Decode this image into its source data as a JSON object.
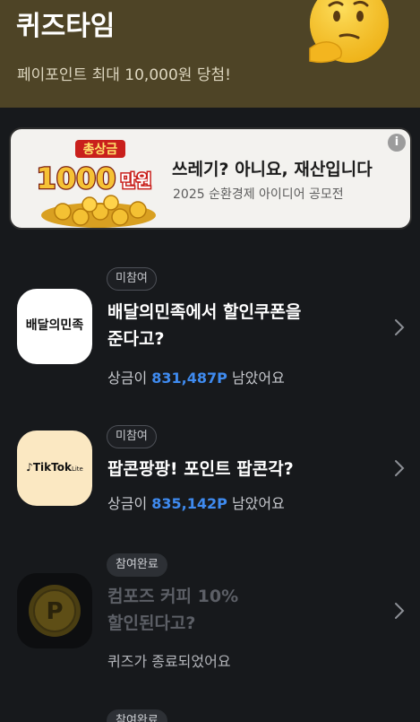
{
  "header": {
    "title": "퀴즈타임",
    "subtitle": "페이포인트 최대 10,000원 당첨!",
    "mascot_icon": "thinking-face-icon",
    "background": "#4e4426"
  },
  "banner": {
    "art_top": "총상금",
    "art_amount": "1000",
    "art_unit": "만원",
    "title": "쓰레기? 아니요, 재산입니다",
    "subtitle": "2025 순환경제 아이디어 공모전",
    "info_icon": "info-icon",
    "info_glyph": "i"
  },
  "quizzes": [
    {
      "badge": "미참여",
      "logo_text": "배달의민족",
      "title_line1": "배달의민족에서 할인쿠폰을",
      "title_line2": "준다고?",
      "prize_prefix": "상금이 ",
      "prize_amount": "831,487P",
      "prize_suffix": " 남았어요"
    },
    {
      "badge": "미참여",
      "logo_text": "TikTok",
      "logo_subtext": "Lite",
      "title_line1": "팝콘팡팡! 포인트 팝콘각?",
      "prize_prefix": "상금이 ",
      "prize_amount": "835,142P",
      "prize_suffix": " 남았어요"
    },
    {
      "badge": "참여완료",
      "logo_text": "P",
      "title_line1": "컴포즈 커피 10%",
      "title_line2": "할인된다고?",
      "status": "퀴즈가 종료되었어요"
    },
    {
      "badge": "참여완료"
    }
  ],
  "colors": {
    "accent_blue": "#3f8bf0",
    "background": "#17191c",
    "baemin_bg": "#ffffff",
    "tiktok_bg": "#fbe8c2"
  }
}
